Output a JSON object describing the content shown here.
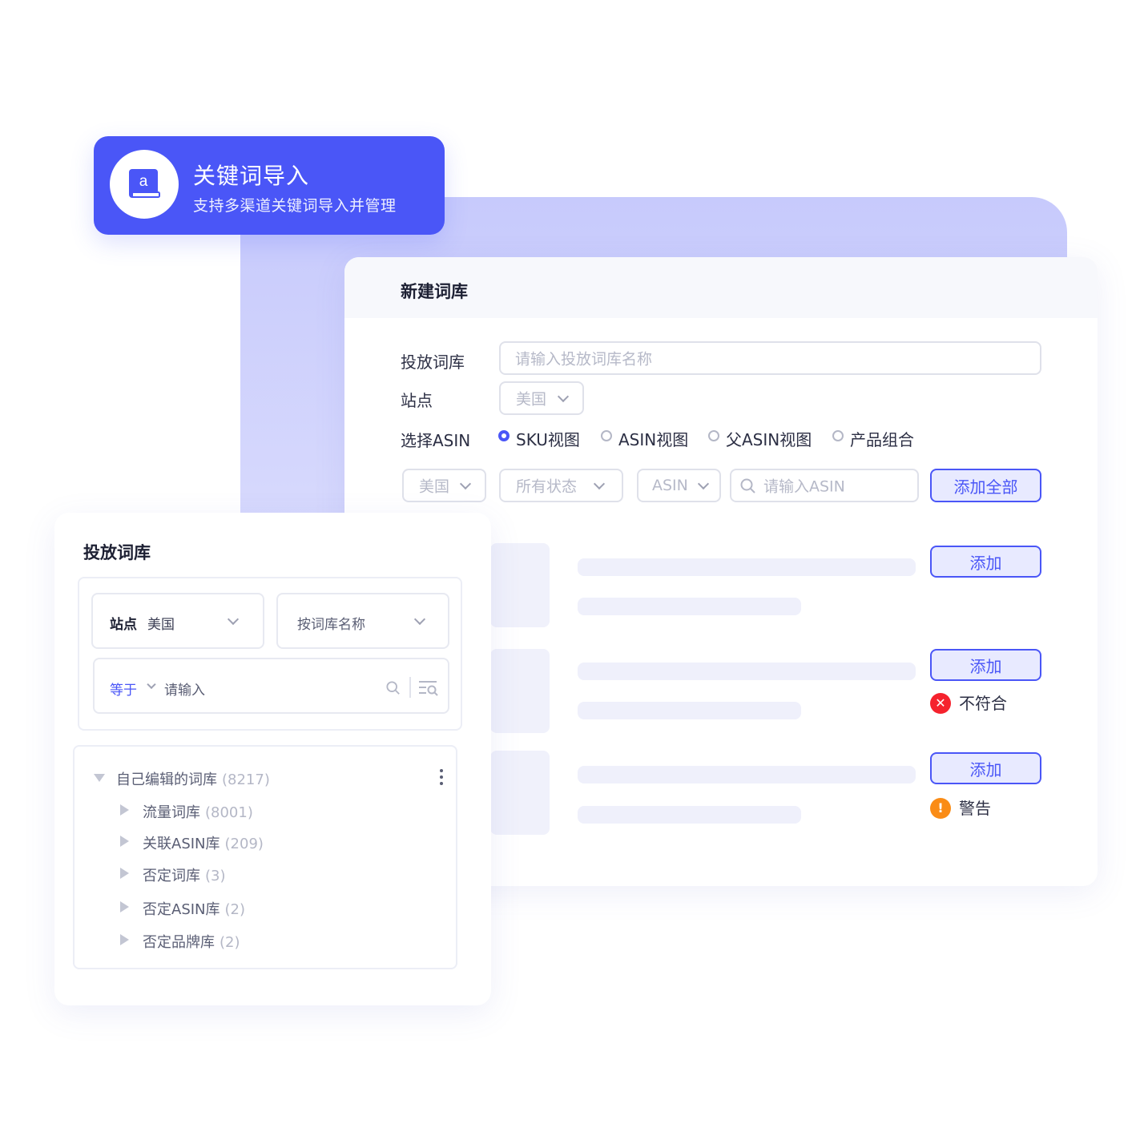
{
  "banner": {
    "title": "关键词导入",
    "subtitle": "支持多渠道关键词导入并管理",
    "icon": "keyword-book-icon",
    "icon_letter": "a",
    "accent_color": "#4a56f7"
  },
  "dialog": {
    "title": "新建词库",
    "form": {
      "library_label": "投放词库",
      "library_placeholder": "请输入投放词库名称",
      "site_label": "站点",
      "site_value": "美国",
      "asin_label": "选择ASIN",
      "views": [
        "SKU视图",
        "ASIN视图",
        "父ASIN视图",
        "产品组合"
      ],
      "selected_view": "SKU视图"
    },
    "filters": {
      "site": "美国",
      "status": "所有状态",
      "type": "ASIN",
      "search_placeholder": "请输入ASIN",
      "add_all": "添加全部"
    },
    "rows": [
      {
        "add_label": "添加",
        "status": ""
      },
      {
        "add_label": "添加",
        "status": "不符合",
        "status_icon": "error-icon",
        "status_color": "#f5222d"
      },
      {
        "add_label": "添加",
        "status": "警告",
        "status_icon": "warning-icon",
        "status_color": "#fa8c16"
      }
    ]
  },
  "panel": {
    "title": "投放词库",
    "site_label": "站点",
    "site_value": "美国",
    "sort_select": "按词库名称",
    "operator": "等于",
    "search_placeholder": "请输入",
    "tree": {
      "root": {
        "label": "自己编辑的词库",
        "count": "(8217)"
      },
      "children": [
        {
          "label": "流量词库",
          "count": "(8001)"
        },
        {
          "label": "关联ASIN库",
          "count": "(209)"
        },
        {
          "label": "否定词库",
          "count": "(3)"
        },
        {
          "label": "否定ASIN库",
          "count": "(2)"
        },
        {
          "label": "否定品牌库",
          "count": "(2)"
        }
      ]
    }
  }
}
